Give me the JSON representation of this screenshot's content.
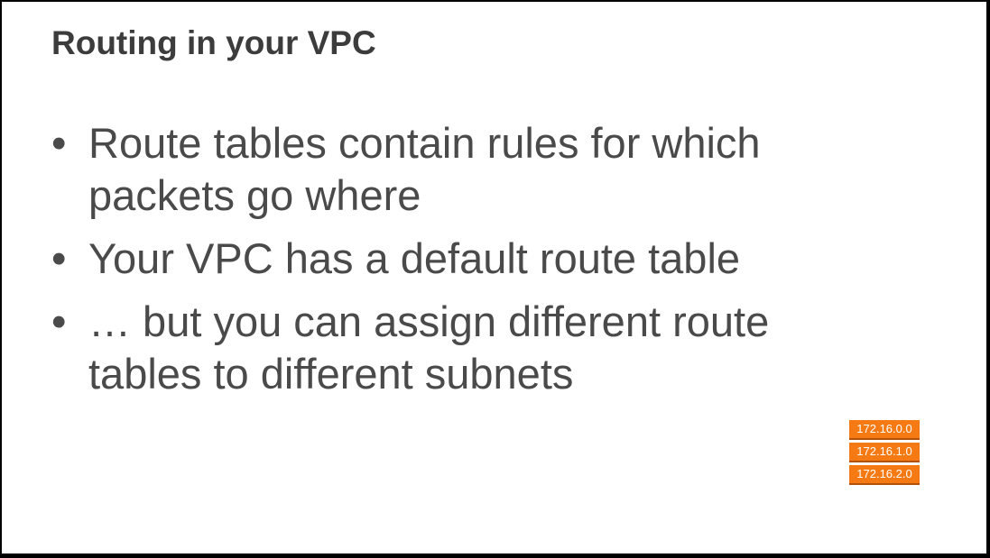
{
  "slide": {
    "title": "Routing in your VPC",
    "bullet_glyph": "•",
    "bullets": [
      {
        "text": "Route tables contain rules for which packets go where"
      },
      {
        "text": "Your VPC has a default route table"
      },
      {
        "text": "… but you can assign different route tables to different subnets"
      }
    ],
    "route_table_graphic": {
      "entries": [
        "172.16.0.0",
        "172.16.1.0",
        "172.16.2.0"
      ],
      "color": "#f57a14"
    }
  }
}
